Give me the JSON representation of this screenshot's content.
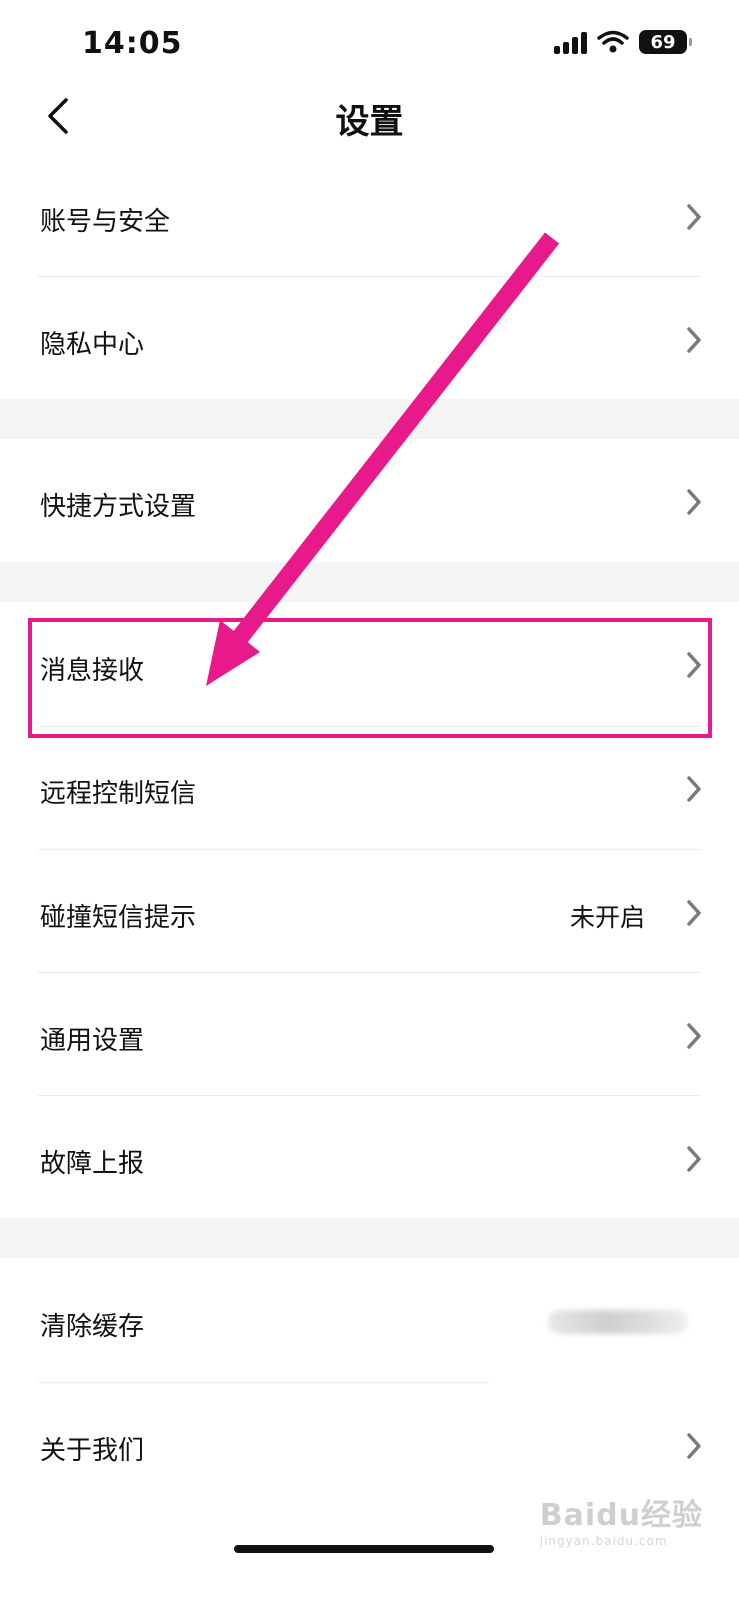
{
  "status_bar": {
    "time": "14:05",
    "battery": "69"
  },
  "header": {
    "title": "设置"
  },
  "settings": {
    "account_security": "账号与安全",
    "privacy_center": "隐私中心",
    "shortcut_settings": "快捷方式设置",
    "message_receive": "消息接收",
    "remote_sms": "远程控制短信",
    "collision_sms": "碰撞短信提示",
    "collision_sms_value": "未开启",
    "general_settings": "通用设置",
    "fault_report": "故障上报",
    "clear_cache": "清除缓存",
    "about_us": "关于我们"
  },
  "watermark": {
    "brand": "Baidu经验",
    "url": "jingyan.baidu.com"
  },
  "colors": {
    "annotation": "#e8198b",
    "background": "#ffffff",
    "section_gap": "#f4f4f4"
  },
  "icons": {
    "back": "chevron-left-icon",
    "row_arrow": "chevron-right-icon",
    "wifi": "wifi-icon",
    "signal": "signal-icon",
    "battery": "battery-icon"
  }
}
